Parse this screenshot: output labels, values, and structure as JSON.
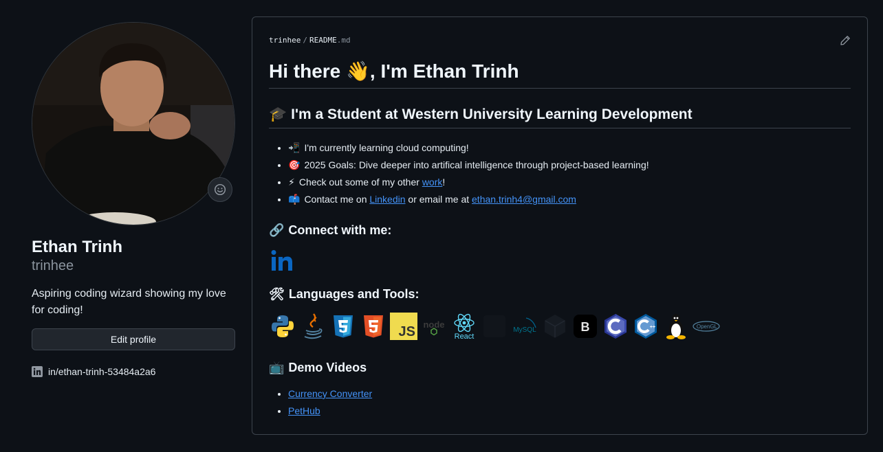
{
  "profile": {
    "full_name": "Ethan Trinh",
    "username": "trinhee",
    "bio": "Aspiring coding wizard showing my love for coding!",
    "edit_label": "Edit profile",
    "social_link": "in/ethan-trinh-53484a2a6"
  },
  "readme": {
    "owner": "trinhee",
    "file": "README",
    "ext": ".md",
    "title": "Hi there 👋, I'm Ethan Trinh",
    "student_emoji": "🎓",
    "student_heading": "I'm a Student at Western University Learning Development",
    "bullets": {
      "b1_emoji": "📲",
      "b1_text": "I'm currently learning cloud computing!",
      "b2_emoji": "🎯",
      "b2_text": "2025 Goals: Dive deeper into artifical intelligence through project-based learning!",
      "b3_emoji": "⚡",
      "b3_pre": "Check out some of my other ",
      "b3_link": "work",
      "b3_post": "!",
      "b4_emoji": "📫",
      "b4_pre": "Contact me on ",
      "b4_link": "Linkedin",
      "b4_mid": " or email me at ",
      "b4_email": "ethan.trinh4@gmail.com"
    },
    "connect_emoji": "🔗",
    "connect_heading": "Connect with me:",
    "tools_emoji": "🛠",
    "tools_heading": "Languages and Tools:",
    "tools": {
      "t_node": "node",
      "t_react": "React",
      "t_mysql": "MySQL",
      "t_js": "JS",
      "t_opengl": "OpenGL"
    },
    "demo_emoji": "📺",
    "demo_heading": "Demo Videos",
    "demos": [
      "Currency Converter",
      "PetHub"
    ]
  },
  "colors": {
    "background": "#0d1117",
    "border": "#3d444d",
    "link": "#4493f8",
    "muted": "#8b949e"
  },
  "icons": [
    "smiley-icon",
    "linkedin-icon",
    "pencil-icon",
    "python-icon",
    "java-icon",
    "css3-icon",
    "html5-icon",
    "javascript-icon",
    "nodejs-icon",
    "react-icon",
    "mongodb-icon",
    "mysql-icon",
    "unity-icon",
    "bootstrap-icon",
    "c-icon",
    "cplusplus-icon",
    "linux-icon",
    "opengl-icon"
  ]
}
